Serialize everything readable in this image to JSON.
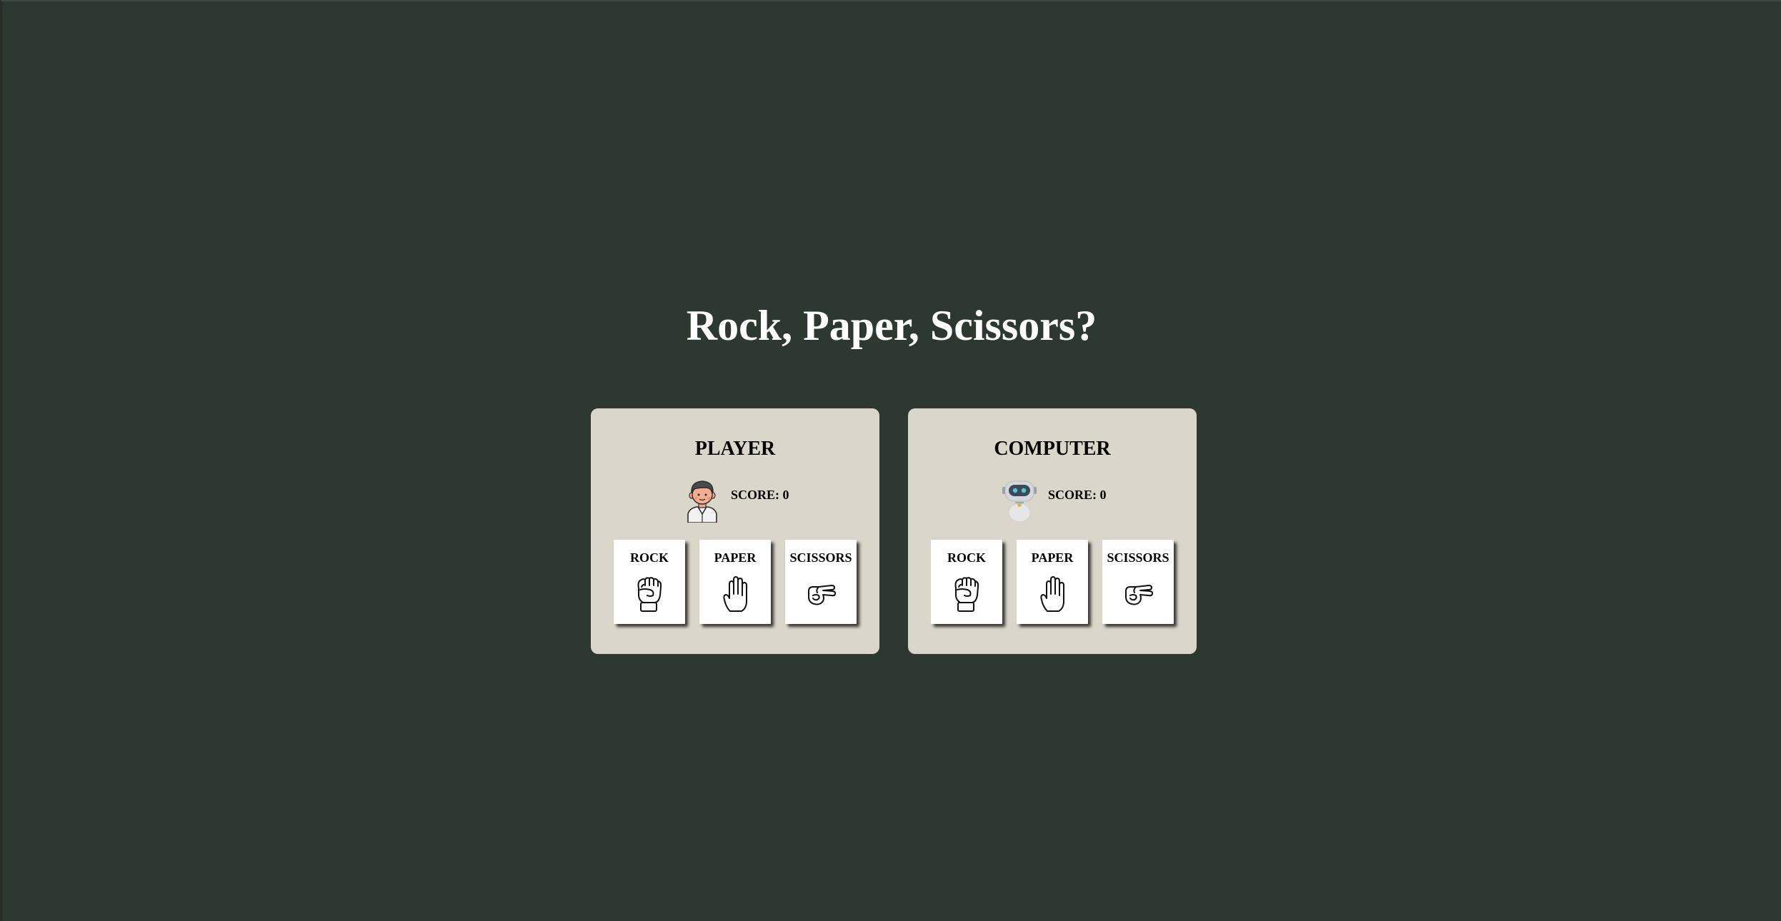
{
  "title": "Rock, Paper, Scissors?",
  "player": {
    "heading": "PLAYER",
    "avatar_icon": "boy-avatar-icon",
    "score": "SCORE: 0",
    "choices": [
      {
        "label": "ROCK",
        "icon": "fist-icon"
      },
      {
        "label": "PAPER",
        "icon": "open-hand-icon"
      },
      {
        "label": "SCISSORS",
        "icon": "scissors-hand-icon"
      }
    ]
  },
  "computer": {
    "heading": "COMPUTER",
    "avatar_icon": "robot-avatar-icon",
    "score": "SCORE: 0",
    "choices": [
      {
        "label": "ROCK",
        "icon": "fist-icon"
      },
      {
        "label": "PAPER",
        "icon": "open-hand-icon"
      },
      {
        "label": "SCISSORS",
        "icon": "scissors-hand-icon"
      }
    ]
  },
  "colors": {
    "background": "#2d3831",
    "panel": "#dad6c9",
    "card": "#ffffff",
    "title_text": "#ffffff"
  }
}
